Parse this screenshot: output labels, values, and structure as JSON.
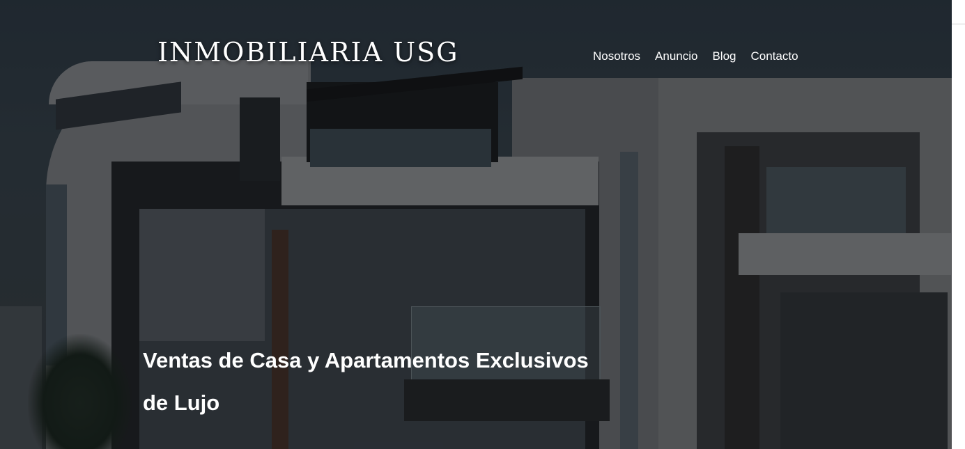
{
  "header": {
    "logo_text": "INMOBILIARIA USG",
    "nav": [
      {
        "label": "Nosotros"
      },
      {
        "label": "Anuncio"
      },
      {
        "label": "Blog"
      },
      {
        "label": "Contacto"
      }
    ]
  },
  "hero": {
    "title": "Ventas de Casa y Apartamentos Exclusivos de Lujo",
    "image_subject": "modern-luxury-house-photo"
  },
  "colors": {
    "overlay": "#14161a",
    "text": "#ffffff",
    "page_background": "#ffffff"
  }
}
